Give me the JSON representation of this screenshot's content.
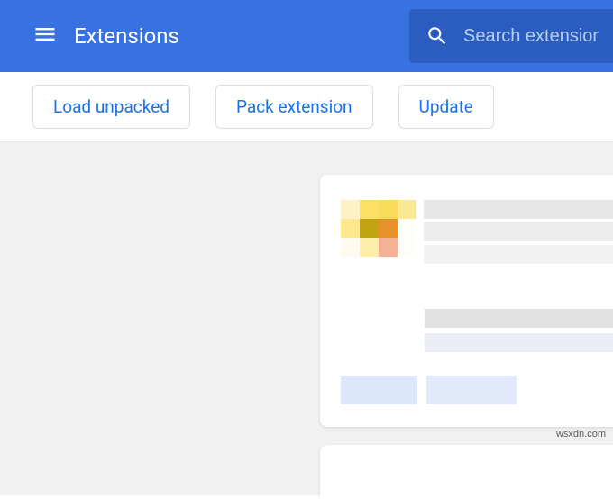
{
  "header": {
    "title": "Extensions",
    "search_placeholder": "Search extensions"
  },
  "toolbar": {
    "load_unpacked": "Load unpacked",
    "pack_extension": "Pack extension",
    "update": "Update"
  },
  "watermark": "wsxdn.com",
  "colors": {
    "primary": "#3871e0",
    "search_bg": "#2b5cbf",
    "link": "#1a73e8",
    "content_bg": "#f1f1f1"
  },
  "extension_card": {
    "icon_pixels": [
      "#fef2c5",
      "#fbdf66",
      "#f8db5b",
      "#fae894",
      "#fde98d",
      "#c1a410",
      "#e79129",
      "#fefef9",
      "#fefbee",
      "#fceea7",
      "#f4b195",
      "#fefdfa"
    ]
  }
}
